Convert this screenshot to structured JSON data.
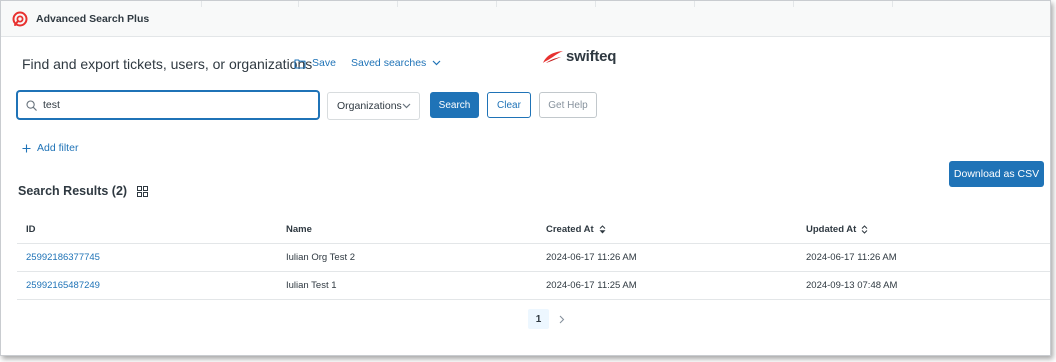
{
  "window": {
    "title": "Advanced Search Plus"
  },
  "header": {
    "heading": "Find and export tickets, users, or organizations",
    "save_label": "Save",
    "saved_searches_label": "Saved searches",
    "brand_name": "swifteq"
  },
  "search": {
    "value": "test",
    "type_selected": "Organizations",
    "search_label": "Search",
    "clear_label": "Clear",
    "help_label": "Get Help"
  },
  "filters": {
    "add_filter_label": "Add filter"
  },
  "results": {
    "title": "Search Results (2)",
    "download_label": "Download as CSV",
    "columns": [
      "ID",
      "Name",
      "Created At",
      "Updated At"
    ],
    "rows": [
      {
        "id": "25992186377745",
        "name": "Iulian Org Test 2",
        "created_at": "2024-06-17 11:26 AM",
        "updated_at": "2024-06-17 11:26 AM"
      },
      {
        "id": "25992165487249",
        "name": "Iulian Test 1",
        "created_at": "2024-06-17 11:25 AM",
        "updated_at": "2024-09-13 07:48 AM"
      }
    ]
  },
  "pagination": {
    "current_page": "1"
  },
  "colors": {
    "accent": "#1f73b7",
    "brand_red": "#e8312f",
    "text": "#2f3941"
  },
  "icons": {
    "app": "app-logo-icon",
    "save": "folder-icon",
    "saved_searches": "chevron-down-icon",
    "search": "search-icon",
    "select": "chevron-down-icon",
    "add_filter": "plus-icon",
    "grid": "grid-icon",
    "created_sort": "sort-desc-icon",
    "updated_sort": "sort-icon",
    "next": "chevron-right-icon"
  }
}
